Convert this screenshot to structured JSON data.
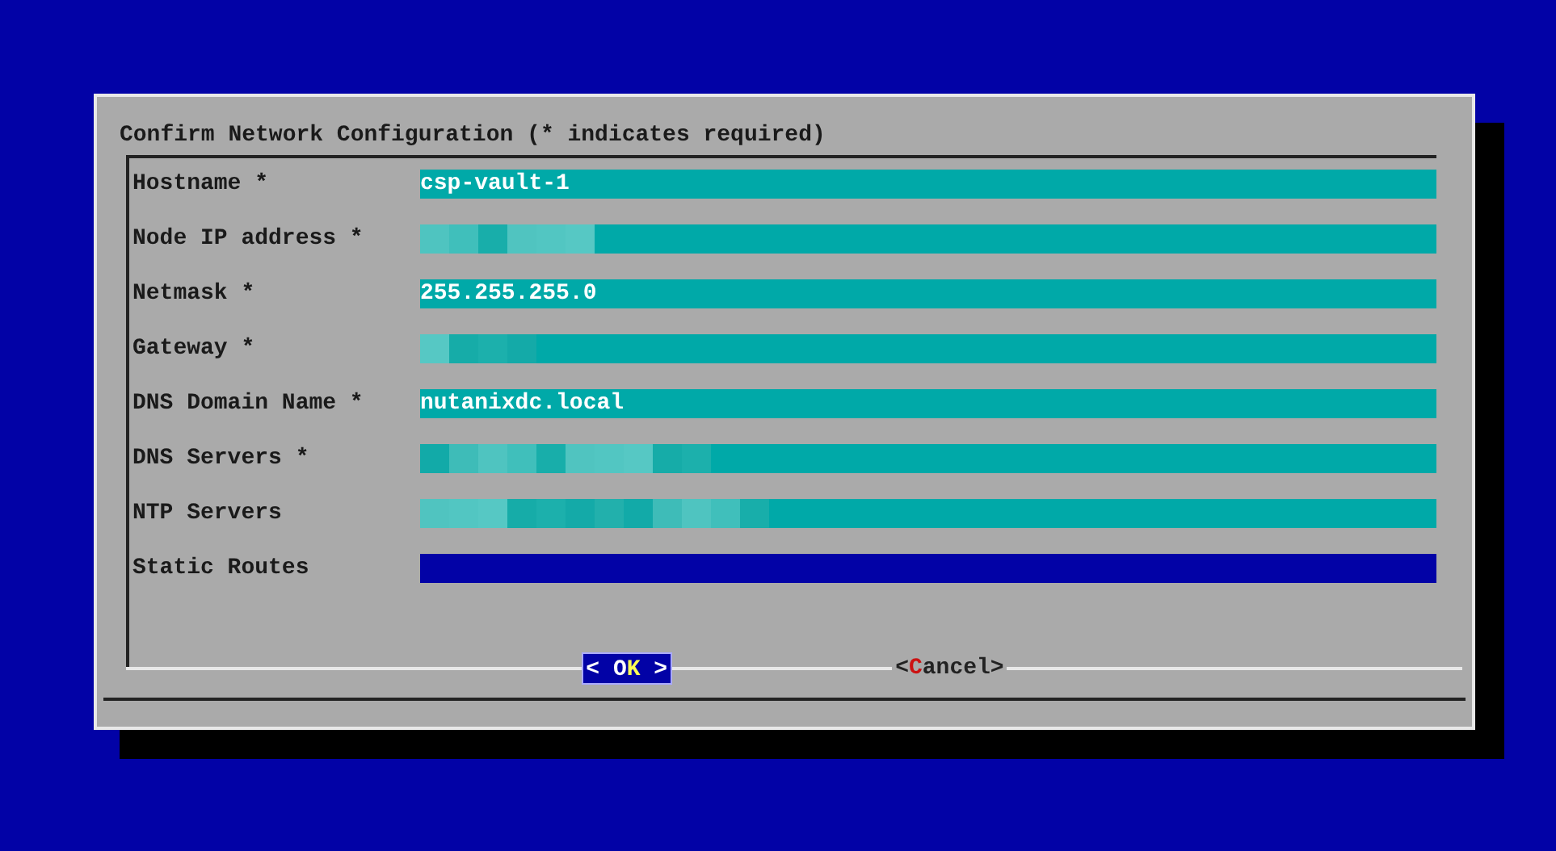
{
  "dialog": {
    "title": "Confirm Network Configuration (* indicates required)"
  },
  "fields": [
    {
      "label": "Hostname *",
      "kind": "text",
      "value": "csp-vault-1",
      "selected": false
    },
    {
      "label": "Node IP address *",
      "kind": "redacted",
      "selected": false
    },
    {
      "label": "Netmask *",
      "kind": "text",
      "value": "255.255.255.0",
      "selected": false
    },
    {
      "label": "Gateway *",
      "kind": "redacted",
      "selected": false
    },
    {
      "label": "DNS Domain Name *",
      "kind": "text",
      "value": "nutanixdc.local",
      "selected": false
    },
    {
      "label": "DNS Servers *",
      "kind": "redacted",
      "selected": false
    },
    {
      "label": "NTP Servers",
      "kind": "redacted",
      "selected": false
    },
    {
      "label": "Static Routes",
      "kind": "text",
      "selected": true
    }
  ],
  "buttons": [
    {
      "before": "< O",
      "hotkey": "K",
      "after": " >",
      "selected": true
    },
    {
      "before": "<",
      "hotkey": "C",
      "after": "ancel>",
      "selected": false
    }
  ]
}
